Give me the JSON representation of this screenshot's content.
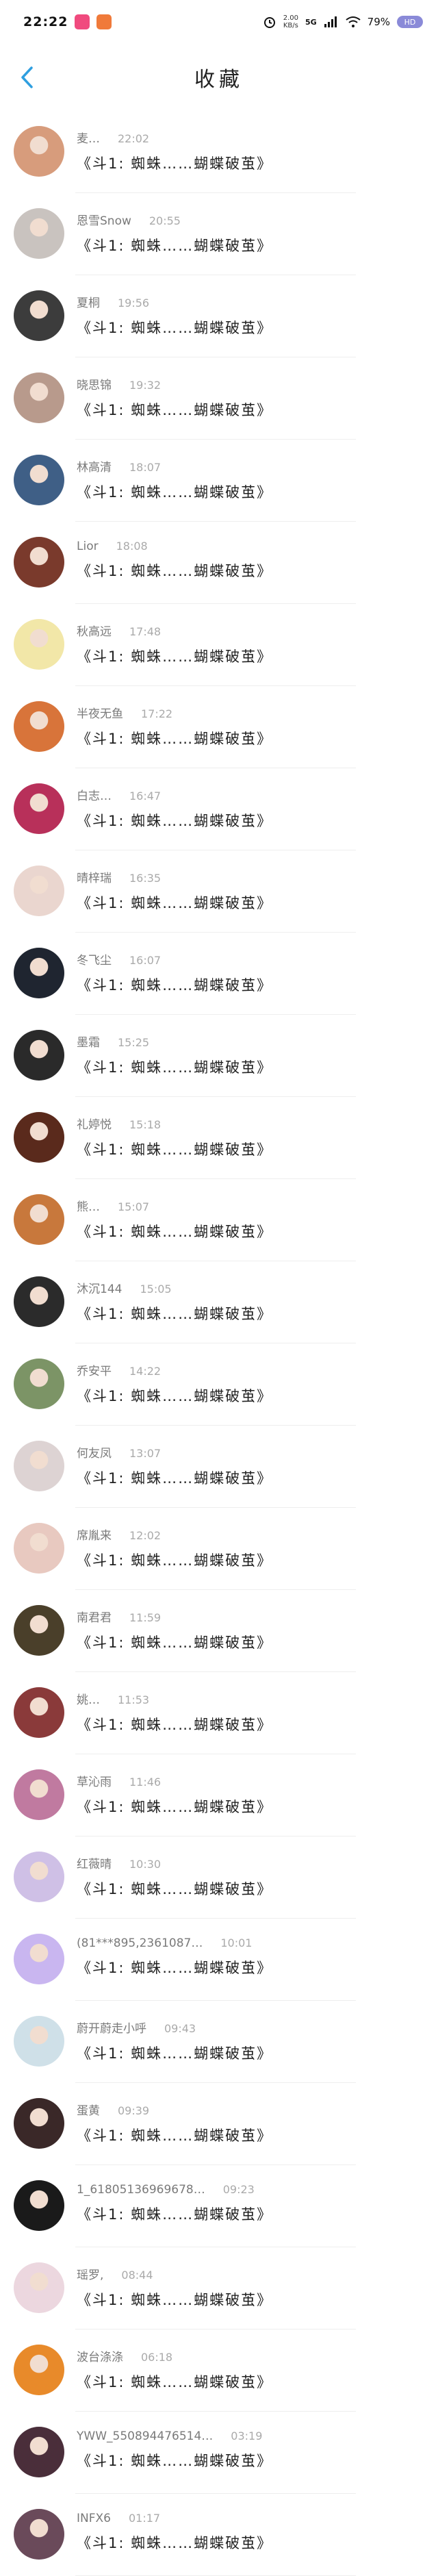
{
  "status_bar": {
    "time": "22:22",
    "net_speed_top": "2.00",
    "net_speed_bottom": "KB/s",
    "signal": "5G",
    "wifi_label": "WiFi",
    "battery_pct": "79%",
    "battery_badge": "HD",
    "app_badge_colors": [
      "#f04a7e",
      "#f07a3a"
    ]
  },
  "header": {
    "title": "收藏",
    "back_icon": "chevron-left-icon",
    "accent": "#2f9fe0"
  },
  "items": [
    {
      "name": "麦…",
      "time": "22:02",
      "msg": "《斗1: 蜘蛛……蝴蝶破茧》",
      "avatar": "#d79c7c"
    },
    {
      "name": "恩雪Snow",
      "time": "20:55",
      "msg": "《斗1: 蜘蛛……蝴蝶破茧》",
      "avatar": "#c9c3bf"
    },
    {
      "name": "夏桐",
      "time": "19:56",
      "msg": "《斗1: 蜘蛛……蝴蝶破茧》",
      "avatar": "#3c3c3c"
    },
    {
      "name": "晓思锦",
      "time": "19:32",
      "msg": "《斗1: 蜘蛛……蝴蝶破茧》",
      "avatar": "#b89a8c"
    },
    {
      "name": "林高清",
      "time": "18:07",
      "msg": "《斗1: 蜘蛛……蝴蝶破茧》",
      "avatar": "#3f5f86"
    },
    {
      "name": "Lior",
      "time": "18:08",
      "msg": "《斗1: 蜘蛛……蝴蝶破茧》",
      "avatar": "#7a3a2c"
    },
    {
      "name": "秋高远",
      "time": "17:48",
      "msg": "《斗1: 蜘蛛……蝴蝶破茧》",
      "avatar": "#f2e7a8"
    },
    {
      "name": "半夜无鱼",
      "time": "17:22",
      "msg": "《斗1: 蜘蛛……蝴蝶破茧》",
      "avatar": "#d8743a"
    },
    {
      "name": "白志…",
      "time": "16:47",
      "msg": "《斗1: 蜘蛛……蝴蝶破茧》",
      "avatar": "#b8305a"
    },
    {
      "name": "晴梓瑞",
      "time": "16:35",
      "msg": "《斗1: 蜘蛛……蝴蝶破茧》",
      "avatar": "#ead6cf"
    },
    {
      "name": "冬飞尘",
      "time": "16:07",
      "msg": "《斗1: 蜘蛛……蝴蝶破茧》",
      "avatar": "#1f2530"
    },
    {
      "name": "墨霜",
      "time": "15:25",
      "msg": "《斗1: 蜘蛛……蝴蝶破茧》",
      "avatar": "#2a2a2a"
    },
    {
      "name": "礼婷悦",
      "time": "15:18",
      "msg": "《斗1: 蜘蛛……蝴蝶破茧》",
      "avatar": "#5a2a1c"
    },
    {
      "name": "熊…",
      "time": "15:07",
      "msg": "《斗1: 蜘蛛……蝴蝶破茧》",
      "avatar": "#c8783c"
    },
    {
      "name": "沐沉144",
      "time": "15:05",
      "msg": "《斗1: 蜘蛛……蝴蝶破茧》",
      "avatar": "#2b2b2b"
    },
    {
      "name": "乔安平",
      "time": "14:22",
      "msg": "《斗1: 蜘蛛……蝴蝶破茧》",
      "avatar": "#7c9466"
    },
    {
      "name": "何友凤",
      "time": "13:07",
      "msg": "《斗1: 蜘蛛……蝴蝶破茧》",
      "avatar": "#ddd3d3"
    },
    {
      "name": "席胤来",
      "time": "12:02",
      "msg": "《斗1: 蜘蛛……蝴蝶破茧》",
      "avatar": "#e8c9c0"
    },
    {
      "name": "南君君",
      "time": "11:59",
      "msg": "《斗1: 蜘蛛……蝴蝶破茧》",
      "avatar": "#4a3f2a"
    },
    {
      "name": "姚…",
      "time": "11:53",
      "msg": "《斗1: 蜘蛛……蝴蝶破茧》",
      "avatar": "#8a3a3a"
    },
    {
      "name": "草沁雨",
      "time": "11:46",
      "msg": "《斗1: 蜘蛛……蝴蝶破茧》",
      "avatar": "#c07aa0"
    },
    {
      "name": "红薇晴",
      "time": "10:30",
      "msg": "《斗1: 蜘蛛……蝴蝶破茧》",
      "avatar": "#cfc0e6"
    },
    {
      "name": "(81***895,2361087…",
      "time": "10:01",
      "msg": "《斗1: 蜘蛛……蝴蝶破茧》",
      "avatar": "#c9b6f0"
    },
    {
      "name": "蔚开蔚走小呼",
      "time": "09:43",
      "msg": "《斗1: 蜘蛛……蝴蝶破茧》",
      "avatar": "#cfe0e8"
    },
    {
      "name": "蛋黄",
      "time": "09:39",
      "msg": "《斗1: 蜘蛛……蝴蝶破茧》",
      "avatar": "#3a2828"
    },
    {
      "name": "1_6180513696967​8…",
      "time": "09:23",
      "msg": "《斗1: 蜘蛛……蝴蝶破茧》",
      "avatar": "#1a1a1a"
    },
    {
      "name": "瑶罗,",
      "time": "08:44",
      "msg": "《斗1: 蜘蛛……蝴蝶破茧》",
      "avatar": "#ecd7df"
    },
    {
      "name": "波台涤涤",
      "time": "06:18",
      "msg": "《斗1: 蜘蛛……蝴蝶破茧》",
      "avatar": "#e88a2a"
    },
    {
      "name": "YWW_550894476514…",
      "time": "03:19",
      "msg": "《斗1: 蜘蛛……蝴蝶破茧》",
      "avatar": "#4a2e3a"
    },
    {
      "name": "INFX6",
      "time": "01:17",
      "msg": "《斗1: 蜘蛛……蝴蝶破茧》",
      "avatar": "#6a4a5a"
    }
  ]
}
